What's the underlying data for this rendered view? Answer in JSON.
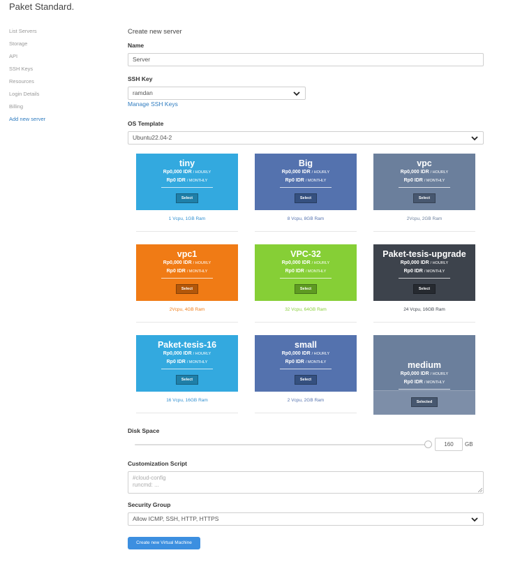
{
  "app_title": "Paket Standard.",
  "sidebar": {
    "items": [
      {
        "label": "List Servers"
      },
      {
        "label": "Storage"
      },
      {
        "label": "API"
      },
      {
        "label": "SSH Keys"
      },
      {
        "label": "Resources"
      },
      {
        "label": "Login Details"
      },
      {
        "label": "Billing"
      },
      {
        "label": "Add new server"
      }
    ],
    "active_color": "#2f7cc0"
  },
  "form": {
    "title": "Create new server",
    "name": {
      "label": "Name",
      "value": "Server"
    },
    "ssh_key": {
      "label": "SSH Key",
      "value": "ramdan",
      "manage_link": "Manage SSH Keys"
    },
    "os_template": {
      "label": "OS Template",
      "value": "Ubuntu22.04-2"
    },
    "plans": [
      {
        "name": "tiny",
        "hourly": "Rp0,000 IDR",
        "hourly_unit": "/ HOURLY",
        "monthly": "Rp0 IDR",
        "monthly_unit": "/ MONTHLY",
        "button": "Select",
        "spec": "1 Vcpu, 1GB Ram",
        "color": "#33a9df",
        "btn_color": "#1f7fa8",
        "spec_color": "#2f8fd0"
      },
      {
        "name": "Big",
        "hourly": "Rp0,000 IDR",
        "hourly_unit": "/ HOURLY",
        "monthly": "Rp0 IDR",
        "monthly_unit": "/ MONTHLY",
        "button": "Select",
        "spec": "8 Vcpu, 8GB Ram",
        "color": "#5472ae",
        "btn_color": "#35507f",
        "spec_color": "#5472ae"
      },
      {
        "name": "vpc",
        "hourly": "Rp0,000 IDR",
        "hourly_unit": "/ HOURLY",
        "monthly": "Rp0 IDR",
        "monthly_unit": "/ MONTHLY",
        "button": "Select",
        "spec": "2Vcpu, 2GB Ram",
        "color": "#6b7f9c",
        "btn_color": "#47576f",
        "spec_color": "#6b7f9c"
      },
      {
        "name": "vpc1",
        "hourly": "Rp0,000 IDR",
        "hourly_unit": "/ HOURLY",
        "monthly": "Rp0 IDR",
        "monthly_unit": "/ MONTHLY",
        "button": "Select",
        "spec": "2Vcpu, 4GB Ram",
        "color": "#f07b15",
        "btn_color": "#b3570a",
        "spec_color": "#f07b15"
      },
      {
        "name": "VPC-32",
        "hourly": "Rp0,000 IDR",
        "hourly_unit": "/ HOURLY",
        "monthly": "Rp0 IDR",
        "monthly_unit": "/ MONTHLY",
        "button": "Select",
        "spec": "32 Vcpu, 64GB Ram",
        "color": "#86cf36",
        "btn_color": "#5e9a22",
        "spec_color": "#86cf36"
      },
      {
        "name": "Paket-tesis-upgrade",
        "hourly": "Rp0,000 IDR",
        "hourly_unit": "/ HOURLY",
        "monthly": "Rp0 IDR",
        "monthly_unit": "/ MONTHLY",
        "button": "Select",
        "spec": "24 Vcpu, 16GB Ram",
        "color": "#3d434c",
        "btn_color": "#262a30",
        "spec_color": "#3d434c"
      },
      {
        "name": "Paket-tesis-16",
        "hourly": "Rp0,000 IDR",
        "hourly_unit": "/ HOURLY",
        "monthly": "Rp0 IDR",
        "monthly_unit": "/ MONTHLY",
        "button": "Select",
        "spec": "16 Vcpu, 16GB Ram",
        "color": "#33a9df",
        "btn_color": "#1f7fa8",
        "spec_color": "#2f8fd0"
      },
      {
        "name": "small",
        "hourly": "Rp0,000 IDR",
        "hourly_unit": "/ HOURLY",
        "monthly": "Rp0 IDR",
        "monthly_unit": "/ MONTHLY",
        "button": "Select",
        "spec": "2 Vcpu, 2GB Ram",
        "color": "#5472ae",
        "btn_color": "#35507f",
        "spec_color": "#5472ae"
      },
      {
        "name": "medium",
        "hourly": "Rp0,000 IDR",
        "hourly_unit": "/ HOURLY",
        "monthly": "Rp0 IDR",
        "monthly_unit": "/ MONTHLY",
        "button": "Selected",
        "spec": "",
        "color": "#6b7f9c",
        "btn_color": "#47576f",
        "spec_color": "#6b7f9c",
        "selected": true
      }
    ],
    "disk_space": {
      "label": "Disk Space",
      "value": "160",
      "unit": "GB",
      "level": 1.0
    },
    "custom_script": {
      "label": "Customization Script",
      "placeholder_line1": "#cloud-config",
      "placeholder_line2": "runcmd: ..."
    },
    "security_group": {
      "label": "Security Group",
      "value": "Allow ICMP, SSH, HTTP, HTTPS"
    },
    "submit": "Create new Virtual Machine"
  }
}
